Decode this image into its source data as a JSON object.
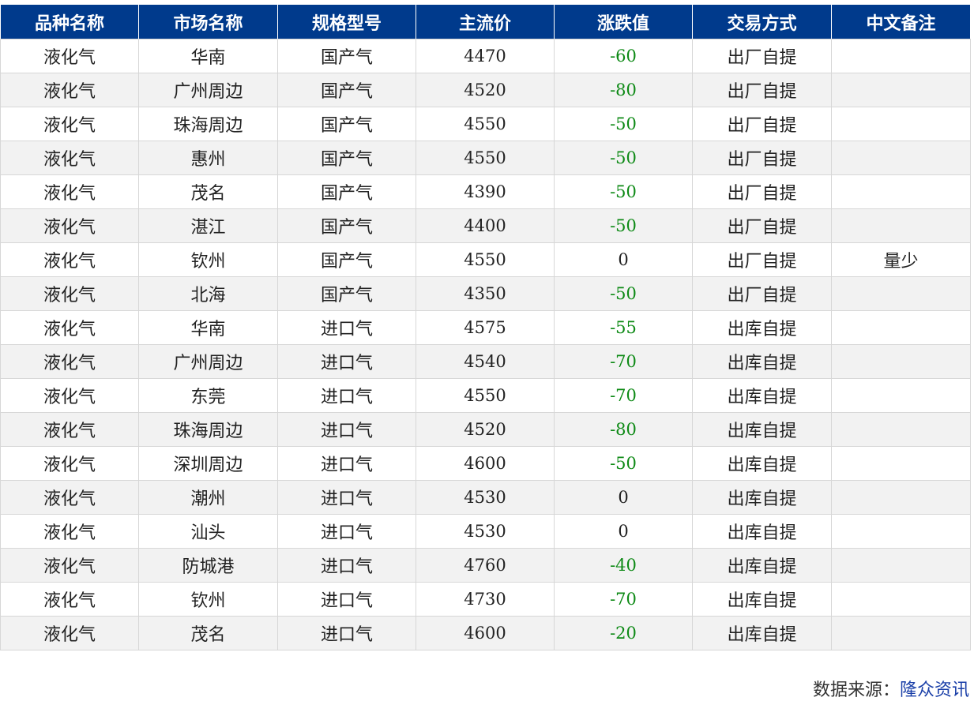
{
  "table": {
    "headers": [
      "品种名称",
      "市场名称",
      "规格型号",
      "主流价",
      "涨跌值",
      "交易方式",
      "中文备注"
    ],
    "rows": [
      [
        "液化气",
        "华南",
        "国产气",
        "4470",
        "-60",
        "出厂自提",
        ""
      ],
      [
        "液化气",
        "广州周边",
        "国产气",
        "4520",
        "-80",
        "出厂自提",
        ""
      ],
      [
        "液化气",
        "珠海周边",
        "国产气",
        "4550",
        "-50",
        "出厂自提",
        ""
      ],
      [
        "液化气",
        "惠州",
        "国产气",
        "4550",
        "-50",
        "出厂自提",
        ""
      ],
      [
        "液化气",
        "茂名",
        "国产气",
        "4390",
        "-50",
        "出厂自提",
        ""
      ],
      [
        "液化气",
        "湛江",
        "国产气",
        "4400",
        "-50",
        "出厂自提",
        ""
      ],
      [
        "液化气",
        "钦州",
        "国产气",
        "4550",
        "0",
        "出厂自提",
        "量少"
      ],
      [
        "液化气",
        "北海",
        "国产气",
        "4350",
        "-50",
        "出厂自提",
        ""
      ],
      [
        "液化气",
        "华南",
        "进口气",
        "4575",
        "-55",
        "出库自提",
        ""
      ],
      [
        "液化气",
        "广州周边",
        "进口气",
        "4540",
        "-70",
        "出库自提",
        ""
      ],
      [
        "液化气",
        "东莞",
        "进口气",
        "4550",
        "-70",
        "出库自提",
        ""
      ],
      [
        "液化气",
        "珠海周边",
        "进口气",
        "4520",
        "-80",
        "出库自提",
        ""
      ],
      [
        "液化气",
        "深圳周边",
        "进口气",
        "4600",
        "-50",
        "出库自提",
        ""
      ],
      [
        "液化气",
        "潮州",
        "进口气",
        "4530",
        "0",
        "出库自提",
        ""
      ],
      [
        "液化气",
        "汕头",
        "进口气",
        "4530",
        "0",
        "出库自提",
        ""
      ],
      [
        "液化气",
        "防城港",
        "进口气",
        "4760",
        "-40",
        "出库自提",
        ""
      ],
      [
        "液化气",
        "钦州",
        "进口气",
        "4730",
        "-70",
        "出库自提",
        ""
      ],
      [
        "液化气",
        "茂名",
        "进口气",
        "4600",
        "-20",
        "出库自提",
        ""
      ]
    ]
  },
  "footer": {
    "source_label": "数据来源：",
    "source_name": "隆众资讯"
  },
  "colors": {
    "header_bg": "#003a8c",
    "negative_change": "#0e8a16",
    "alt_row_bg": "#f2f2f2"
  }
}
